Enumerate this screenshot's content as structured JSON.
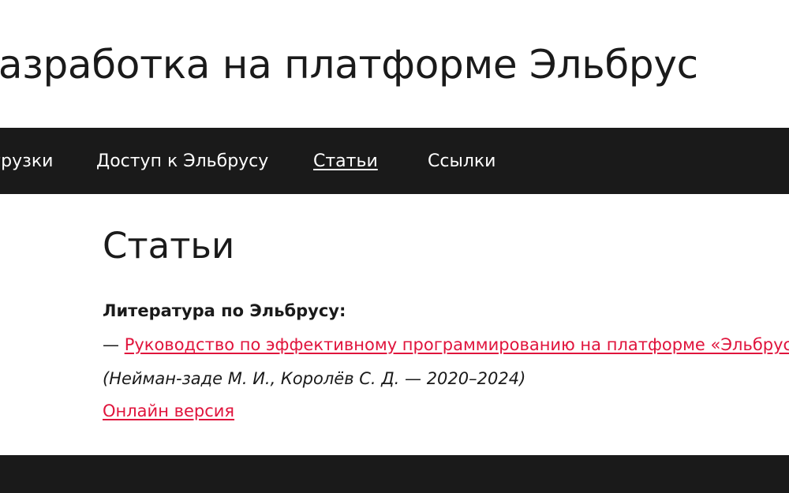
{
  "header": {
    "site_title": "Разработка на платформе Эльбрус"
  },
  "nav": {
    "items": [
      {
        "label": "Загрузки"
      },
      {
        "label": "Доступ к Эльбрусу"
      },
      {
        "label": "Статьи",
        "current": true
      },
      {
        "label": "Ссылки"
      }
    ]
  },
  "main": {
    "page_title": "Статьи",
    "section_heading": "Литература по Эльбрусу:",
    "entry": {
      "dash": "— ",
      "link_text": "Руководство по эффективному программированию на платформе «Эльбрус»",
      "authors": "(Нейман-заде М. И., Королёв С. Д. — 2020–2024)",
      "online_link": "Онлайн версия"
    }
  },
  "colors": {
    "link": "#e0143c",
    "nav_background": "#1a1a1a",
    "text": "#1a1a1a"
  }
}
